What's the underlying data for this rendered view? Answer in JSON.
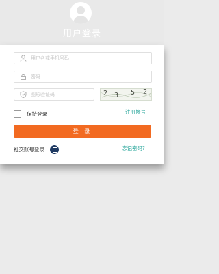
{
  "header": {
    "title": "用户登录",
    "avatar_icon": "user-avatar-icon"
  },
  "form": {
    "username": {
      "placeholder": "用户名或手机号码",
      "value": "",
      "icon": "user-icon"
    },
    "password": {
      "placeholder": "密码",
      "value": "",
      "icon": "lock-icon"
    },
    "captcha": {
      "placeholder": "图形验证码",
      "value": "",
      "icon": "shield-icon",
      "image_text": [
        "2",
        "3",
        "5",
        "2"
      ]
    },
    "remember_label": "保持登录",
    "register_link": "注册帐号",
    "login_button": "登 录",
    "social_label": "社交账号登录",
    "social_icon": "qq-icon",
    "forgot_link": "忘记密码?"
  },
  "colors": {
    "header_bg": "#e9e9e9",
    "accent": "#f26a21",
    "link": "#26a59a",
    "page_bg": "#ebebeb"
  }
}
